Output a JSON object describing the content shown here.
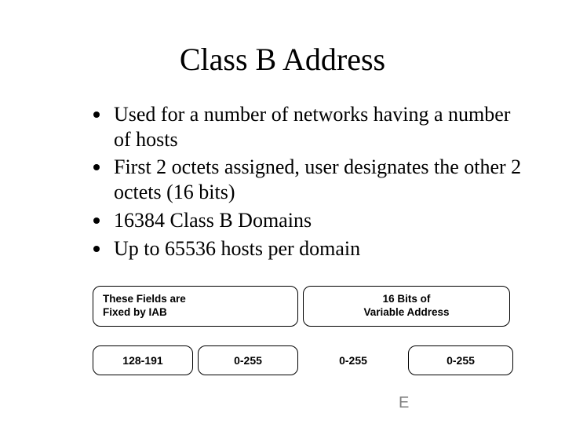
{
  "title": "Class B Address",
  "bullets": [
    "Used for a number of networks having a number of hosts",
    "First 2 octets assigned, user designates the other 2 octets (16 bits)",
    "16384 Class B Domains",
    " Up to 65536 hosts per domain"
  ],
  "labels": {
    "fixed": "These Fields are\nFixed by IAB",
    "variable": "16 Bits of\nVariable Address"
  },
  "octets": [
    "128-191",
    "0-255",
    "0-255",
    "0-255"
  ],
  "footer": "E"
}
